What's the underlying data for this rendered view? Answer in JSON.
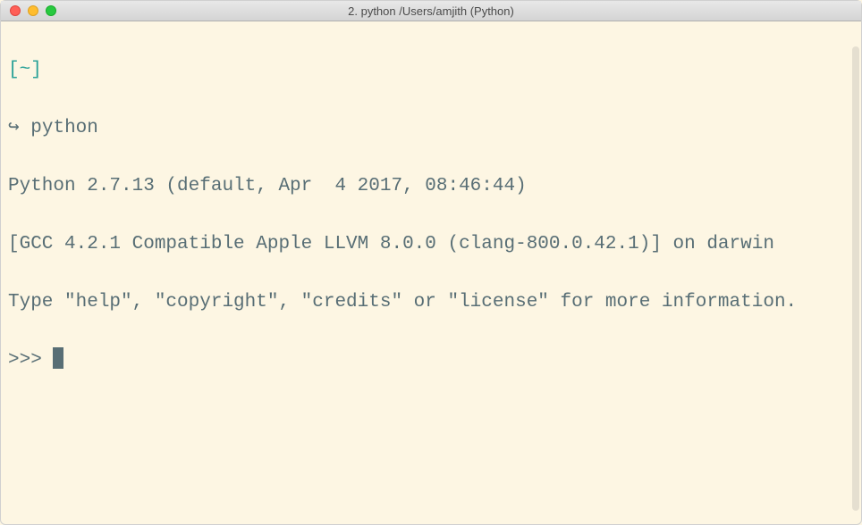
{
  "window": {
    "title": "2. python  /Users/amjith (Python)"
  },
  "terminal": {
    "prompt_path": "[~]",
    "arrow_glyph": "↪",
    "command": "python",
    "output_line1": "Python 2.7.13 (default, Apr  4 2017, 08:46:44)",
    "output_line2": "[GCC 4.2.1 Compatible Apple LLVM 8.0.0 (clang-800.0.42.1)] on darwin",
    "output_line3": "Type \"help\", \"copyright\", \"credits\" or \"license\" for more information.",
    "repl_prompt": ">>> "
  }
}
